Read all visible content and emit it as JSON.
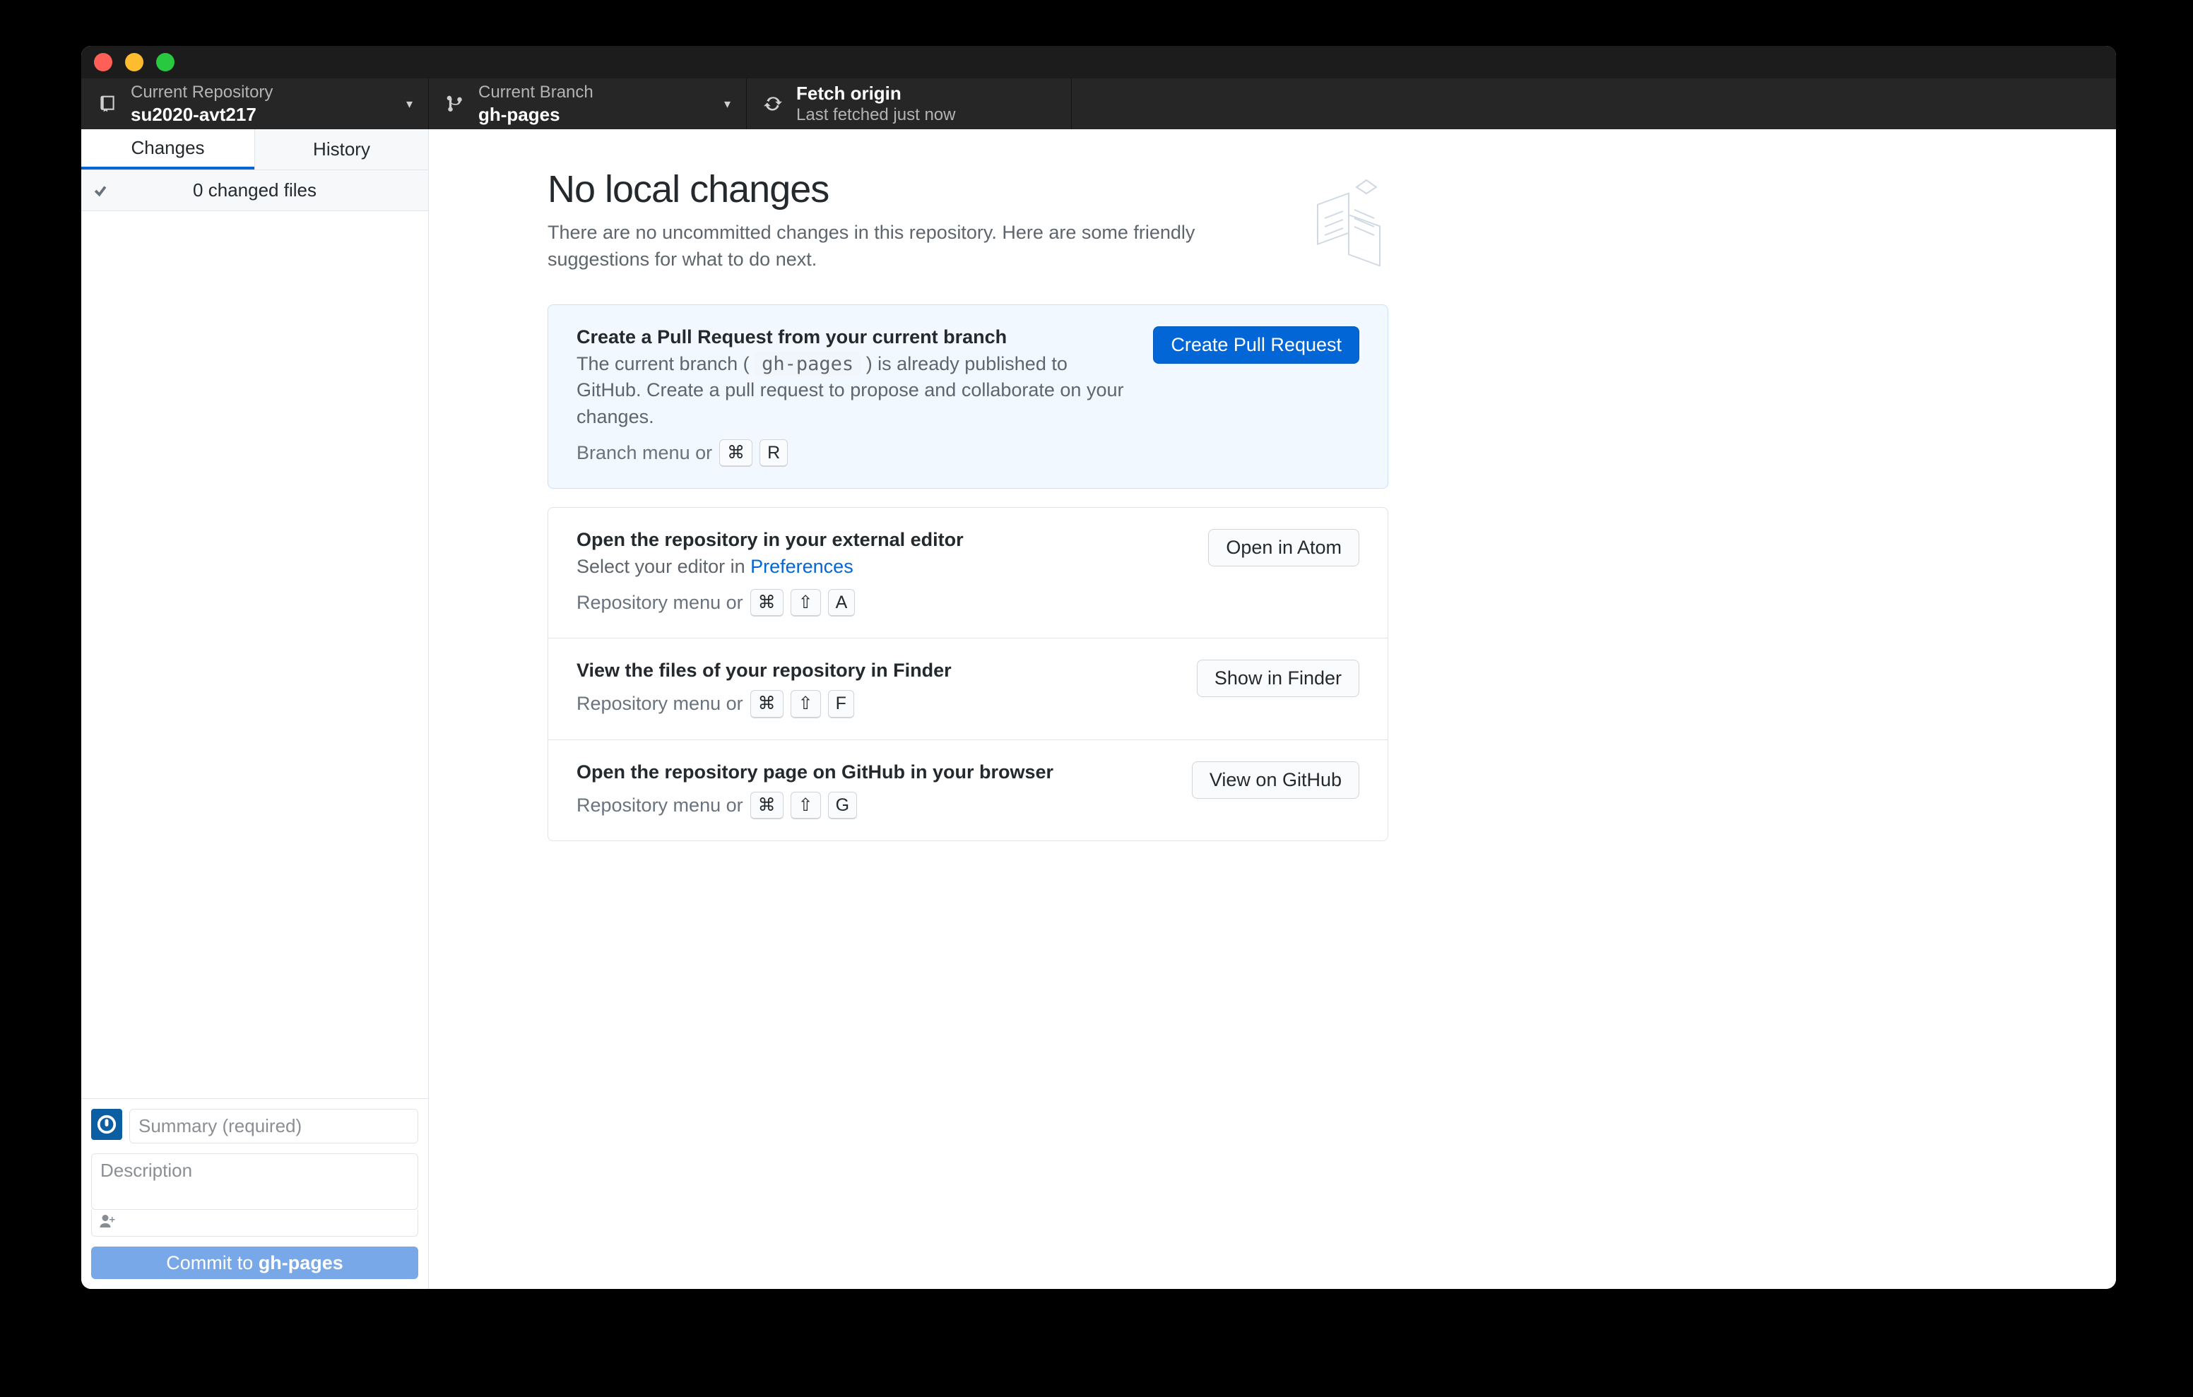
{
  "toolbar": {
    "repo": {
      "label": "Current Repository",
      "value": "su2020-avt217"
    },
    "branch": {
      "label": "Current Branch",
      "value": "gh-pages"
    },
    "fetch": {
      "title": "Fetch origin",
      "subtitle": "Last fetched just now"
    }
  },
  "sidebar": {
    "tabs": {
      "changes": "Changes",
      "history": "History"
    },
    "changed_files": "0 changed files",
    "commit": {
      "summary_placeholder": "Summary (required)",
      "description_placeholder": "Description",
      "button_prefix": "Commit to ",
      "button_branch": "gh-pages"
    }
  },
  "main": {
    "headline": "No local changes",
    "subtitle": "There are no uncommitted changes in this repository. Here are some friendly suggestions for what to do next.",
    "cards": {
      "pr": {
        "title": "Create a Pull Request from your current branch",
        "desc_pre": "The current branch (",
        "desc_code": "gh-pages",
        "desc_post": ") is already published to GitHub. Create a pull request to propose and collaborate on your changes.",
        "hint": "Branch menu or",
        "kbd": [
          "⌘",
          "R"
        ],
        "button": "Create Pull Request"
      },
      "editor": {
        "title": "Open the repository in your external editor",
        "desc_pre": "Select your editor in ",
        "link": "Preferences",
        "hint": "Repository menu or",
        "kbd": [
          "⌘",
          "⇧",
          "A"
        ],
        "button": "Open in Atom"
      },
      "finder": {
        "title": "View the files of your repository in Finder",
        "hint": "Repository menu or",
        "kbd": [
          "⌘",
          "⇧",
          "F"
        ],
        "button": "Show in Finder"
      },
      "github": {
        "title": "Open the repository page on GitHub in your browser",
        "hint": "Repository menu or",
        "kbd": [
          "⌘",
          "⇧",
          "G"
        ],
        "button": "View on GitHub"
      }
    }
  }
}
